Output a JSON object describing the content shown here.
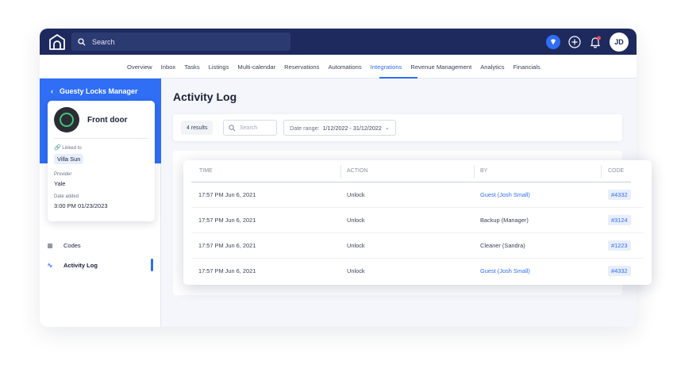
{
  "topbar": {
    "search_placeholder": "Search",
    "avatar_initials": "JD"
  },
  "nav": {
    "items": [
      "Overview",
      "Inbox",
      "Tasks",
      "Listings",
      "Multi-calendar",
      "Reservations",
      "Automations",
      "Integrations",
      "Revenue Management",
      "Analytics",
      "Financials"
    ],
    "active": "Integrations"
  },
  "sidebar": {
    "back_title": "Guesty Locks Manager",
    "lock": {
      "name": "Front door",
      "linked_label": "Linked to",
      "linked_value": "Villa Sun",
      "provider_label": "Provider",
      "provider_value": "Yale",
      "date_label": "Date added",
      "date_value": "3:00 PM 01/23/2023"
    },
    "menu": [
      {
        "label": "Codes",
        "icon": "grid-icon"
      },
      {
        "label": "Activity Log",
        "icon": "pulse-icon",
        "active": true
      }
    ]
  },
  "main": {
    "title": "Activity Log",
    "filters": {
      "results": "4 results",
      "search_placeholder": "Search",
      "date_label": "Date range:",
      "date_value": "1/12/2022 - 31/12/2022"
    },
    "table": {
      "headers": [
        "TIME",
        "ACTION",
        "BY",
        "CODE"
      ],
      "rows": [
        {
          "time": "17:57 PM Jun 6, 2021",
          "action": "Unlock",
          "by": "Guest (Josh Small)",
          "code": "#4332"
        },
        {
          "time": "17:57 PM Jun 6, 2021",
          "action": "Unlock",
          "by": "Backup (Manager)",
          "code": "#3124"
        },
        {
          "time": "17:57 PM Jun 6, 2021",
          "action": "Unlock",
          "by": "Cleaner (Sandra)",
          "code": "#1223"
        },
        {
          "time": "17:57 PM Jun 6, 2021",
          "action": "Unlock",
          "by": "Guest (Josh Small)",
          "code": "#4332"
        }
      ]
    }
  },
  "colors": {
    "topbar": "#1e2a5e",
    "accent": "#2f6ef5",
    "notification_dot": "#ef4b5a"
  }
}
